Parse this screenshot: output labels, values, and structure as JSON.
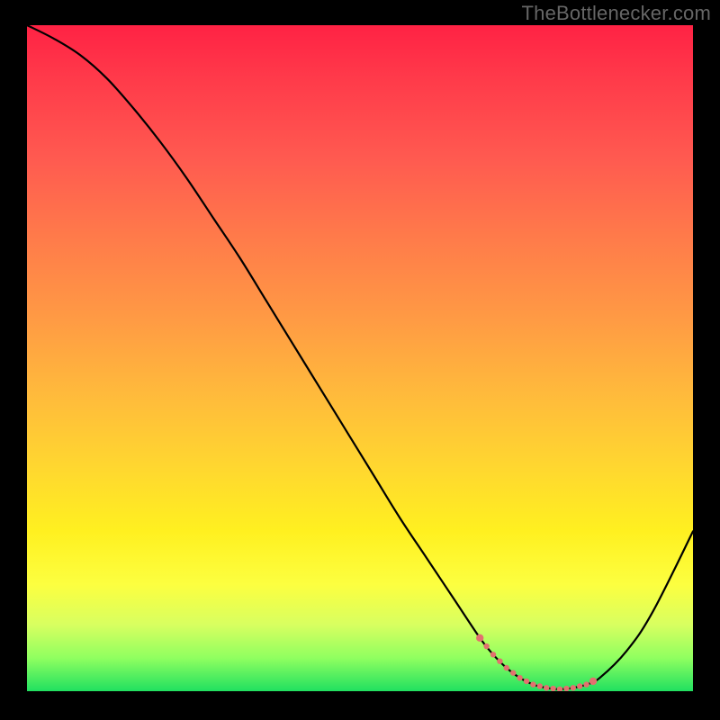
{
  "watermark": "TheBottleneсker.com",
  "chart_data": {
    "type": "line",
    "title": "",
    "xlabel": "",
    "ylabel": "",
    "xlim": [
      0,
      100
    ],
    "ylim": [
      0,
      100
    ],
    "x": [
      0,
      4,
      8,
      12,
      16,
      20,
      24,
      28,
      32,
      36,
      40,
      44,
      48,
      52,
      56,
      60,
      64,
      68,
      70,
      72,
      74,
      76,
      78,
      80,
      82,
      84,
      86,
      90,
      94,
      100
    ],
    "values": [
      100,
      98,
      95.5,
      92,
      87.5,
      82.5,
      77,
      71,
      65,
      58.5,
      52,
      45.5,
      39,
      32.5,
      26,
      20,
      14,
      8,
      5.5,
      3.5,
      2,
      1,
      0.5,
      0.3,
      0.5,
      1,
      2,
      6,
      12,
      24
    ],
    "flat_highlight": {
      "start_x": 68,
      "end_x": 85,
      "color": "#e2716f",
      "note": "dotted pink/coral segment near bottom minimum"
    },
    "gradient_stops": [
      {
        "pos": 0,
        "color": "#ff2244"
      },
      {
        "pos": 50,
        "color": "#ffb000"
      },
      {
        "pos": 80,
        "color": "#ffff30"
      },
      {
        "pos": 100,
        "color": "#20e060"
      }
    ]
  },
  "plot": {
    "inner_left": 30,
    "inner_top": 28,
    "inner_width": 740,
    "inner_height": 740
  }
}
